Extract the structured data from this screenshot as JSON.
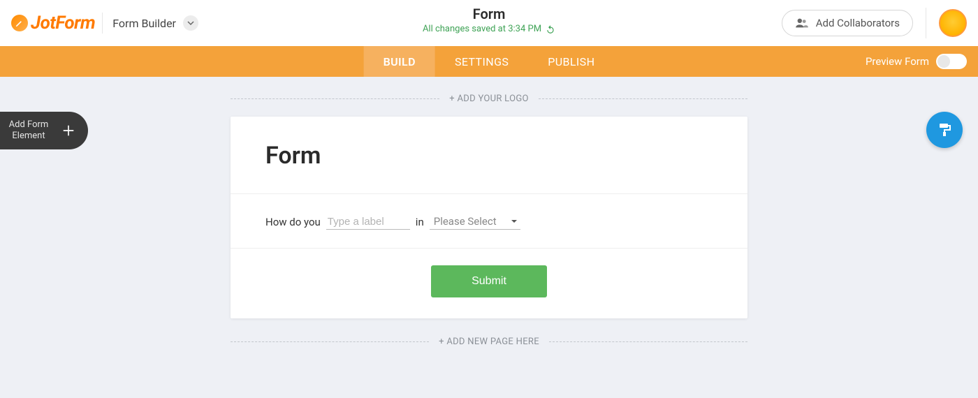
{
  "header": {
    "brand": "JotForm",
    "form_builder_label": "Form Builder",
    "form_title": "Form",
    "saved_text": "All changes saved at 3:34 PM",
    "collaborators_label": "Add Collaborators"
  },
  "nav": {
    "tabs": [
      {
        "label": "BUILD",
        "active": true
      },
      {
        "label": "SETTINGS",
        "active": false
      },
      {
        "label": "PUBLISH",
        "active": false
      }
    ],
    "preview_label": "Preview Form"
  },
  "canvas": {
    "add_logo_label": "+ ADD YOUR LOGO",
    "form_heading": "Form",
    "question": {
      "prefix": "How do you",
      "label_placeholder": "Type a label",
      "middle": "in",
      "select_placeholder": "Please Select"
    },
    "submit_label": "Submit",
    "add_page_label": "+ ADD NEW PAGE HERE"
  },
  "side": {
    "add_element_line1": "Add Form",
    "add_element_line2": "Element"
  },
  "colors": {
    "orange_bar": "#f4a23a",
    "green": "#5cb85c"
  }
}
